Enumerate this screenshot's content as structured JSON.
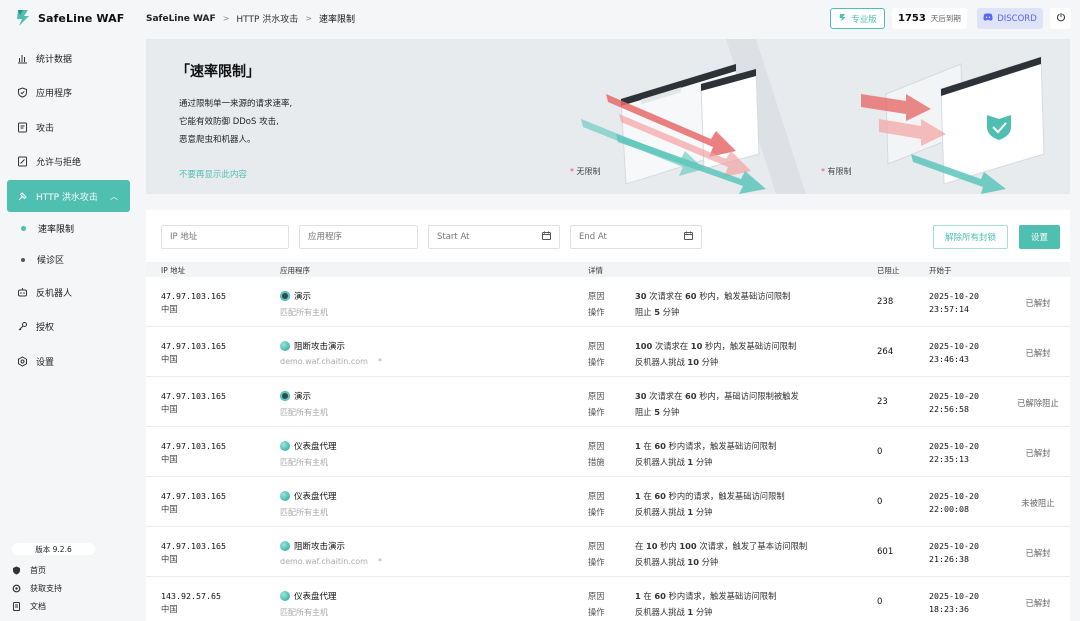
{
  "app": {
    "name": "SafeLine WAF"
  },
  "sidebar": {
    "items": [
      {
        "label": "统计数据",
        "icon": "bar-chart-icon"
      },
      {
        "label": "应用程序",
        "icon": "shield-icon"
      },
      {
        "label": "攻击",
        "icon": "document-icon"
      },
      {
        "label": "允许与拒绝",
        "icon": "list-icon"
      },
      {
        "label": "HTTP 洪水攻击",
        "icon": "hammer-icon",
        "active": true
      },
      {
        "label": "反机器人",
        "icon": "robot-icon"
      },
      {
        "label": "授权",
        "icon": "key-icon"
      },
      {
        "label": "设置",
        "icon": "gear-icon"
      }
    ],
    "sub_items": [
      {
        "label": "速率限制",
        "active": true
      },
      {
        "label": "候诊区"
      }
    ],
    "version": "版本 9.2.6",
    "footer": [
      {
        "label": "首页",
        "icon": "shield-small-icon"
      },
      {
        "label": "获取支持",
        "icon": "support-icon"
      },
      {
        "label": "文档",
        "icon": "doc-icon"
      }
    ]
  },
  "header": {
    "breadcrumb": [
      "SafeLine WAF",
      "HTTP 洪水攻击",
      "速率限制"
    ],
    "pro_label": "专业版",
    "days_number": "1753",
    "days_label": "天后到期",
    "discord_label": "DISCORD"
  },
  "banner": {
    "title": "「速率限制」",
    "desc": [
      "通过限制单一来源的请求速率,",
      "它能有效防御 DDoS 攻击,",
      "恶意爬虫和机器人。"
    ],
    "hide_link": "不要再显示此内容",
    "label_no_limit": "无限制",
    "label_limit": "有限制"
  },
  "filters": {
    "ip_placeholder": "IP 地址",
    "app_placeholder": "应用程序",
    "start_placeholder": "Start At",
    "end_placeholder": "End At",
    "unblock_all": "解除所有封锁",
    "settings": "设置"
  },
  "table": {
    "headers": {
      "ip": "IP 地址",
      "app": "应用程序",
      "detail": "详情",
      "blocked": "已阻止",
      "start": "开始于"
    },
    "rows": [
      {
        "ip": "47.97.103.165",
        "country": "中国",
        "app": "演示",
        "app_icon": "demo",
        "host": "匹配所有主机",
        "host_star": "",
        "l1": "原因",
        "l2": "操作",
        "d1": "30 次请求在 60 秒内，触发基础访问限制",
        "d2": "阻止 5 分钟",
        "blocked": "238",
        "date": "2025-10-20",
        "time": "23:57:14",
        "status": "已解封"
      },
      {
        "ip": "47.97.103.165",
        "country": "中国",
        "app": "阻断攻击演示",
        "app_icon": "globe",
        "host": "demo.waf.chaitin.com",
        "host_star": "*",
        "l1": "原因",
        "l2": "操作",
        "d1": "100 次请求在 10 秒内，触发基础访问限制",
        "d2": "反机器人挑战 10 分钟",
        "blocked": "264",
        "date": "2025-10-20",
        "time": "23:46:43",
        "status": "已解封"
      },
      {
        "ip": "47.97.103.165",
        "country": "中国",
        "app": "演示",
        "app_icon": "demo",
        "host": "匹配所有主机",
        "host_star": "",
        "l1": "原因",
        "l2": "操作",
        "d1": "30 次请求在 60 秒内，基础访问限制被触发",
        "d2": "阻止 5 分钟",
        "blocked": "23",
        "date": "2025-10-20",
        "time": "22:56:58",
        "status": "已解除阻止"
      },
      {
        "ip": "47.97.103.165",
        "country": "中国",
        "app": "仪表盘代理",
        "app_icon": "globe",
        "host": "匹配所有主机",
        "host_star": "",
        "l1": "原因",
        "l2": "措施",
        "d1": "1 在 60 秒内请求，触发基础访问限制",
        "d2": "反机器人挑战 1 分钟",
        "blocked": "0",
        "date": "2025-10-20",
        "time": "22:35:13",
        "status": "已解封"
      },
      {
        "ip": "47.97.103.165",
        "country": "中国",
        "app": "仪表盘代理",
        "app_icon": "globe",
        "host": "匹配所有主机",
        "host_star": "",
        "l1": "原因",
        "l2": "操作",
        "d1": "1 在 60 秒内的请求，触发基础访问限制",
        "d2": "反机器人挑战 1 分钟",
        "blocked": "0",
        "date": "2025-10-20",
        "time": "22:00:08",
        "status": "未被阻止"
      },
      {
        "ip": "47.97.103.165",
        "country": "中国",
        "app": "阻断攻击演示",
        "app_icon": "globe",
        "host": "demo.waf.chaitin.com",
        "host_star": "*",
        "l1": "原因",
        "l2": "操作",
        "d1": "在 10 秒内 100 次请求，触发了基本访问限制",
        "d2": "反机器人挑战 10 分钟",
        "blocked": "601",
        "date": "2025-10-20",
        "time": "21:26:38",
        "status": "已解封"
      },
      {
        "ip": "143.92.57.65",
        "country": "中国",
        "app": "仪表盘代理",
        "app_icon": "globe",
        "host": "匹配所有主机",
        "host_star": "",
        "l1": "原因",
        "l2": "操作",
        "d1": "1 在 60 秒内请求，触发基础访问限制",
        "d2": "反机器人挑战 1 分钟",
        "blocked": "0",
        "date": "2025-10-20",
        "time": "18:23:36",
        "status": "已解封"
      }
    ]
  },
  "colors": {
    "accent": "#4fbfb2",
    "discord": "#5865f2",
    "arrow_red": "#e66a6a"
  }
}
